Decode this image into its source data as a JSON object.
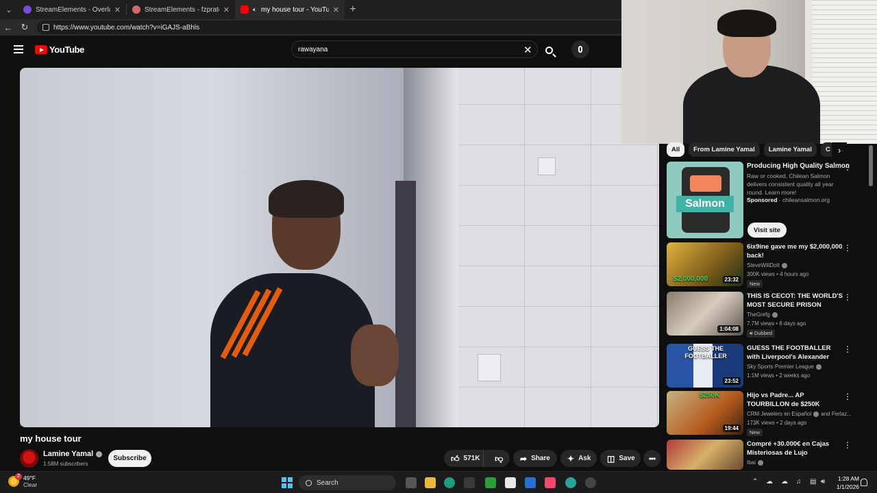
{
  "browser": {
    "tabs": [
      {
        "title": "StreamElements - Overlays",
        "favicon_color": "#7b4bd8",
        "active": false
      },
      {
        "title": "StreamElements - fzprato",
        "favicon_color": "#d06a6a",
        "active": false
      },
      {
        "title": "my house tour - YouTube",
        "favicon_color": "#ff0000",
        "active": true
      }
    ],
    "url": "https://www.youtube.com/watch?v=iGAJS-aBhls"
  },
  "header": {
    "logo_text": "YouTube",
    "search_value": "rawayana"
  },
  "video": {
    "title": "my house tour",
    "channel": "Lamine Yamal",
    "subscribers": "1.58M subscribers",
    "subscribe_label": "Subscribe",
    "likes": "571K",
    "share_label": "Share",
    "ask_label": "Ask",
    "save_label": "Save"
  },
  "sidebar": {
    "chips": [
      "All",
      "From Lamine Yamal",
      "Lamine Yamal",
      "C"
    ],
    "ad": {
      "title": "Producing High Quality Salmon",
      "description": "Raw or cooked, Chilean Salmon delivers consistent quality all year round. Learn more!",
      "sponsored": "Sponsored",
      "domain": "chileansalmon.org",
      "thumb_word": "Salmon",
      "visit_label": "Visit site"
    },
    "recommendations": [
      {
        "title": "6ix9ine gave me my $2,000,000 back!",
        "channel": "SteveWillDoIt",
        "verified": true,
        "meta": "300K views • 4 hours ago",
        "badge": "New",
        "duration": "23:32",
        "thumb_text": "$2,000,000"
      },
      {
        "title": "THIS IS CECOT: THE WORLD'S MOST SECURE PRISON",
        "channel": "TheGrefg",
        "verified": true,
        "meta": "7.7M views • 8 days ago",
        "badge": "Dubbed",
        "duration": "1:04:08",
        "thumb_text": ""
      },
      {
        "title": "GUESS THE FOOTBALLER with Liverpool's Alexander Isak & ...",
        "channel": "Sky Sports Premier League",
        "verified": true,
        "meta": "1.1M views • 2 weeks ago",
        "badge": "",
        "duration": "23:52",
        "thumb_text": "GUESS THE FOOTBALLER"
      },
      {
        "title": "Hijo vs Padre... AP TOURBILLON de $250K",
        "channel": "CRM Jewelers en Español",
        "verified": true,
        "channel_extra": "and Ferlaz...",
        "meta": "173K views • 2 days ago",
        "badge": "New",
        "duration": "19:44",
        "thumb_text": "$250K"
      },
      {
        "title": "Compré +30.000€ en Cajas Misteriosas de Lujo",
        "channel": "Ibai",
        "verified": true,
        "meta": "",
        "badge": "",
        "duration": "",
        "thumb_text": ""
      }
    ]
  },
  "taskbar": {
    "temperature": "49°F",
    "condition": "Clear",
    "weather_badge": "2",
    "search_label": "Search",
    "time": "1:28 AM",
    "date": "1/1/2026"
  }
}
